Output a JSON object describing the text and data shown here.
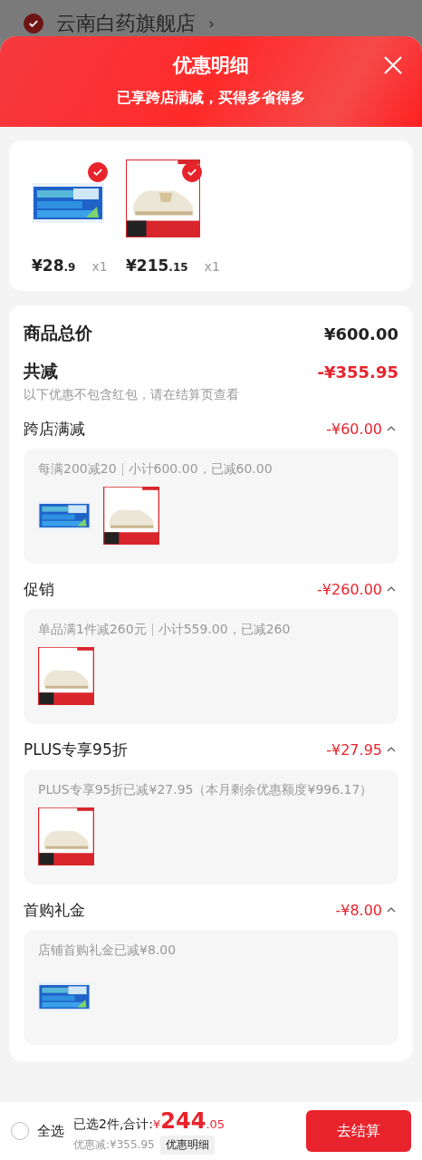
{
  "background_shop": {
    "name": "云南白药旗舰店",
    "arrow": "›",
    "checked": true
  },
  "sheet": {
    "title": "优惠明细",
    "subtitle": "已享跨店满减，买得多省得多"
  },
  "products": [
    {
      "kind": "toothpaste",
      "checked": true,
      "price_main": "¥28",
      "price_decimal": ".9",
      "quantity": "x1"
    },
    {
      "kind": "shoe",
      "checked": true,
      "price_main": "¥215",
      "price_decimal": ".15",
      "quantity": "x1"
    }
  ],
  "summary": {
    "total_label": "商品总价",
    "total_value": "¥600.00",
    "discount_label": "共减",
    "discount_value": "-¥355.95",
    "note": "以下优惠不包含红包，请在结算页查看"
  },
  "sections": [
    {
      "title": "跨店满减",
      "amount": "-¥60.00",
      "expanded": true,
      "rule": "每满200减20",
      "detail": "小计600.00，已减60.00",
      "items": [
        {
          "kind": "toothpaste"
        },
        {
          "kind": "shoe"
        }
      ]
    },
    {
      "title": "促销",
      "amount": "-¥260.00",
      "expanded": true,
      "rule": "单品满1件减260元",
      "detail": "小计559.00，已减260",
      "items": [
        {
          "kind": "shoe"
        }
      ]
    },
    {
      "title": "PLUS专享95折",
      "amount": "-¥27.95",
      "expanded": true,
      "detail": "PLUS专享95折已减¥27.95（本月剩余优惠额度¥996.17）",
      "items": [
        {
          "kind": "shoe"
        }
      ]
    },
    {
      "title": "首购礼金",
      "amount": "-¥8.00",
      "expanded": true,
      "detail": "店铺首购礼金已减¥8.00",
      "items": [
        {
          "kind": "toothpaste"
        }
      ]
    }
  ],
  "bottom_bar": {
    "select_all": {
      "label": "全选",
      "checked": false
    },
    "selected_count": "已选2件,合计:",
    "total_currency": "¥",
    "total_integer": "244",
    "total_decimal": ".05",
    "saved": "优惠减:¥355.95",
    "detail_button": "优惠明细",
    "checkout_button": "去结算"
  }
}
